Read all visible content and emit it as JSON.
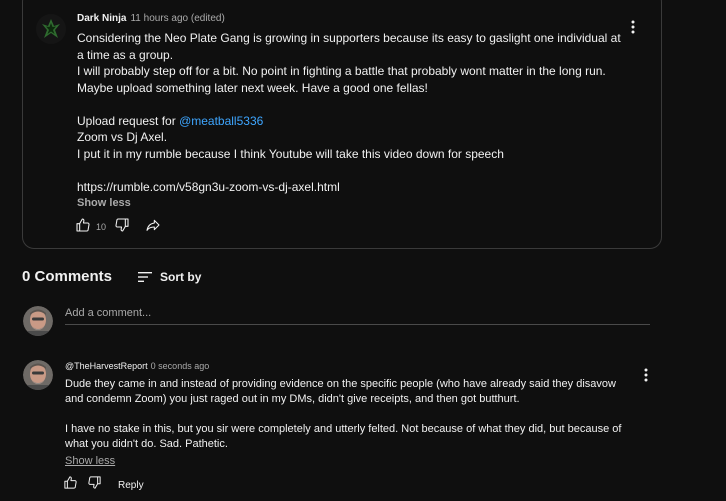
{
  "post": {
    "author": "Dark Ninja",
    "time": "11 hours ago (edited)",
    "lines": [
      "Considering the Neo Plate Gang is growing in supporters because its easy to gaslight one individual at a time as a group.",
      "I will probably step off for a bit. No point in fighting a battle that probably wont matter in the long run.",
      "Maybe upload something later next week. Have a good one fellas!"
    ],
    "upload_prefix": "Upload request for ",
    "mention": "@meatball5336",
    "lines2": [
      "Zoom vs Dj Axel.",
      "I put it in my rumble because I think Youtube will take this video down for speech"
    ],
    "link": "https://rumble.com/v58gn3u-zoom-vs-dj-axel.html",
    "show_less": "Show less",
    "like_count": "10"
  },
  "comments_section": {
    "count_label": "0 Comments",
    "sort_label": "Sort by",
    "add_placeholder": "Add a comment..."
  },
  "comment": {
    "handle": "@TheHarvestReport",
    "time": "0 seconds ago",
    "para1": "Dude they came in and instead of providing evidence on the specific people (who have already said they disavow and condemn Zoom) you just raged out in my DMs, didn't give receipts, and then got butthurt.",
    "para2": "I have no stake in this, but you sir were completely and utterly felted. Not because of what they did, but because of what you didn't do. Sad. Pathetic.",
    "show_less": "Show less",
    "reply_label": "Reply"
  },
  "icons": [
    "like-icon",
    "dislike-icon",
    "share-icon",
    "more-vert-icon",
    "sort-icon"
  ],
  "colors": {
    "background": "#0f0f0f",
    "text": "#f1f1f1",
    "muted": "#aaaaaa",
    "link": "#3ea6ff"
  }
}
